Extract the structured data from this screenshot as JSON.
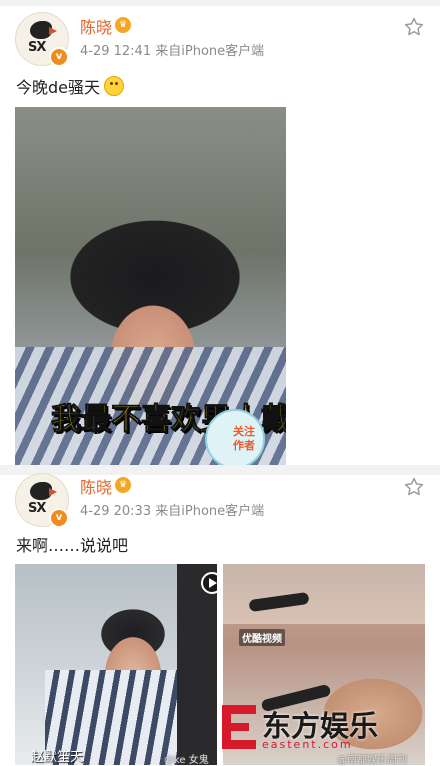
{
  "posts": [
    {
      "author": "陈晓",
      "time": "4-29 12:41",
      "source": "来自iPhone客户端",
      "text": "今晚de骚天",
      "emoji_icon": "smile-emoji-icon",
      "image_caption": "我最不喜欢男人戴墨镜！",
      "follow_badge": "关注作者"
    },
    {
      "author": "陈晓",
      "time": "4-29 20:33",
      "source": "来自iPhone客户端",
      "text": "来啊……说说吧",
      "image_left_caption": "赵默笙天",
      "image_right_tag": "优酷视频"
    }
  ],
  "avatar_text": "SX",
  "badge_v": "v",
  "watermark": {
    "brand": "东方娱乐",
    "sub": "eastent.com",
    "small": "@南都娱乐周刊",
    "small2": "@ke  女鬼"
  },
  "colors": {
    "author_name": "#e8632a",
    "watermark_red": "#d7192c",
    "caption_yellow": "#ffe400",
    "meta_gray": "#8a8a8a"
  }
}
